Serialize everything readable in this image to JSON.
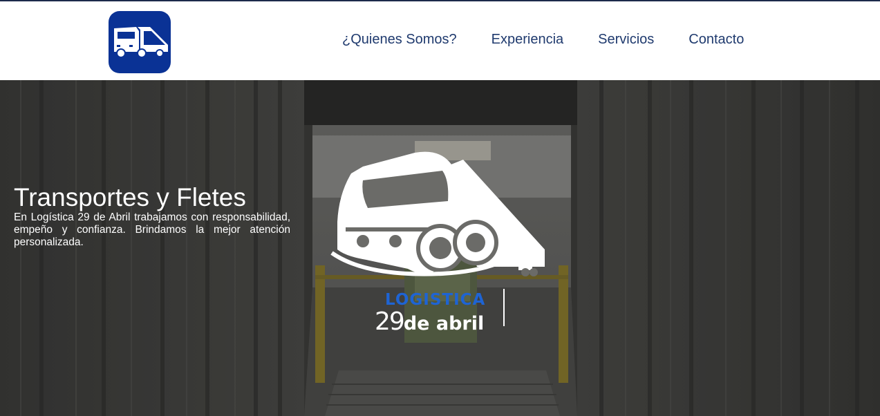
{
  "header": {
    "logo_icon": "truck-logo-icon",
    "nav": [
      {
        "label": "¿Quienes Somos?"
      },
      {
        "label": "Experiencia"
      },
      {
        "label": "Servicios"
      },
      {
        "label": "Contacto"
      }
    ]
  },
  "hero": {
    "title": "Transportes y Fletes",
    "description": "En Logística 29 de Abril trabajamos con responsabilidad, empeño y confianza. Brindamos la mejor atención personalizada.",
    "background": "warehouse-loading-dock-photo",
    "brand": {
      "line1": "LOGISTICA",
      "number": "29",
      "words": "de abril"
    }
  },
  "colors": {
    "brand_blue": "#0a3295",
    "nav_text": "#1f3a6e",
    "brand_text_blue": "#1e64d4"
  }
}
